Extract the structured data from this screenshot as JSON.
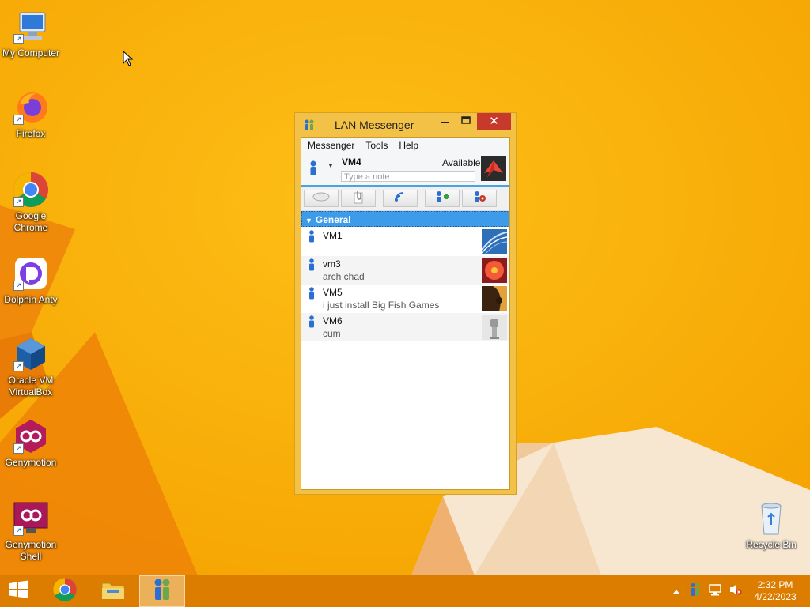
{
  "desktop": {
    "icons": [
      {
        "label": "My Computer"
      },
      {
        "label": "Firefox"
      },
      {
        "label": "Google Chrome"
      },
      {
        "label": "Dolphin Anty"
      },
      {
        "label": "Oracle VM VirtualBox"
      },
      {
        "label": "Genymotion"
      },
      {
        "label": "Genymotion Shell"
      },
      {
        "label": "Recycle Bin"
      }
    ]
  },
  "window": {
    "title": "LAN Messenger",
    "menu": [
      "Messenger",
      "Tools",
      "Help"
    ],
    "user": {
      "name": "VM4",
      "status": "Available",
      "note_placeholder": "Type a note"
    },
    "group": "General",
    "contacts": [
      {
        "name": "VM1",
        "note": ""
      },
      {
        "name": "vm3",
        "note": "arch chad"
      },
      {
        "name": "VM5",
        "note": "i just install Big Fish Games"
      },
      {
        "name": "VM6",
        "note": "cum"
      }
    ]
  },
  "taskbar": {
    "time": "2:32 PM",
    "date": "4/22/2023"
  },
  "colors": {
    "wallpaper": "#f6a800",
    "taskbar": "#d97a00",
    "group_header": "#3d9be9",
    "close_button": "#c7392b"
  }
}
